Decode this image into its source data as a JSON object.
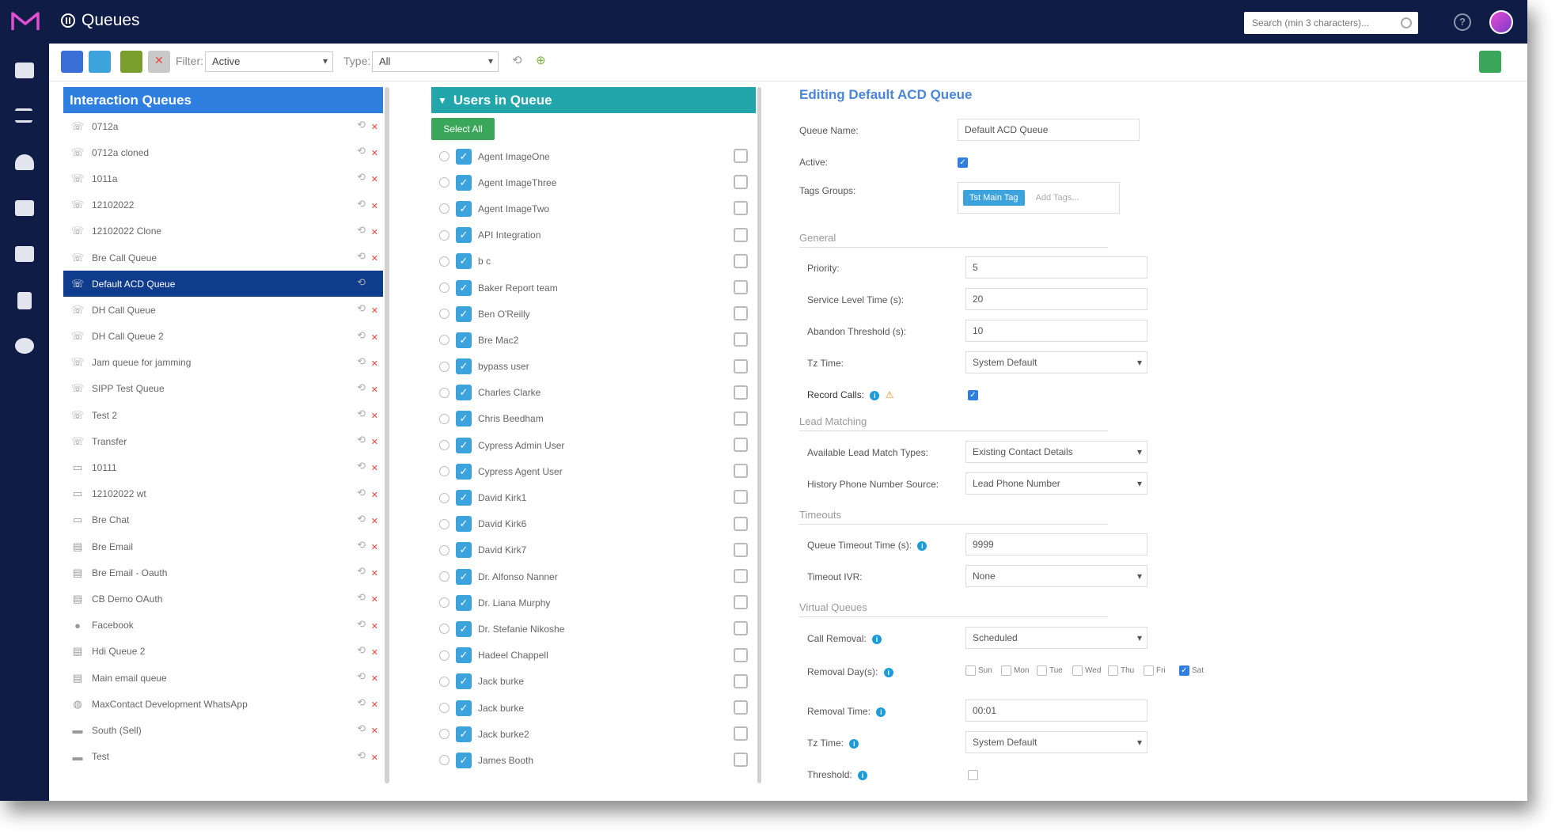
{
  "app": {
    "title": "Queues"
  },
  "header": {
    "search_placeholder": "Search (min 3 characters)..."
  },
  "toolbar": {
    "filter_label": "Filter:",
    "filter_value": "Active",
    "type_label": "Type:",
    "type_value": "All"
  },
  "queues": {
    "header": "Interaction Queues",
    "items": [
      {
        "icon": "phone-icon",
        "name": "0712a",
        "selected": false
      },
      {
        "icon": "phone-icon",
        "name": "0712a cloned",
        "selected": false
      },
      {
        "icon": "phone-icon",
        "name": "1011a",
        "selected": false
      },
      {
        "icon": "phone-icon",
        "name": "12102022",
        "selected": false
      },
      {
        "icon": "phone-icon",
        "name": "12102022 Clone",
        "selected": false
      },
      {
        "icon": "phone-icon",
        "name": "Bre Call Queue",
        "selected": false
      },
      {
        "icon": "phone-icon",
        "name": "Default ACD Queue",
        "selected": true
      },
      {
        "icon": "phone-icon",
        "name": "DH Call Queue",
        "selected": false
      },
      {
        "icon": "phone-icon",
        "name": "DH Call Queue 2",
        "selected": false
      },
      {
        "icon": "phone-icon",
        "name": "Jam queue for jamming",
        "selected": false
      },
      {
        "icon": "phone-icon",
        "name": "SIPP Test Queue",
        "selected": false
      },
      {
        "icon": "phone-icon",
        "name": "Test 2",
        "selected": false
      },
      {
        "icon": "phone-icon",
        "name": "Transfer",
        "selected": false
      },
      {
        "icon": "chat-icon",
        "name": "10111",
        "selected": false
      },
      {
        "icon": "chat-icon",
        "name": "12102022 wt",
        "selected": false
      },
      {
        "icon": "chat-icon",
        "name": "Bre Chat",
        "selected": false
      },
      {
        "icon": "email-icon",
        "name": "Bre Email",
        "selected": false
      },
      {
        "icon": "email-icon",
        "name": "Bre Email - Oauth",
        "selected": false
      },
      {
        "icon": "email-icon",
        "name": "CB Demo OAuth",
        "selected": false
      },
      {
        "icon": "facebook-icon",
        "name": "Facebook",
        "selected": false
      },
      {
        "icon": "email-icon",
        "name": "Hdi Queue 2",
        "selected": false
      },
      {
        "icon": "email-icon",
        "name": "Main email queue",
        "selected": false
      },
      {
        "icon": "whatsapp-icon",
        "name": "MaxContact Development WhatsApp",
        "selected": false
      },
      {
        "icon": "sms-icon",
        "name": "South (Sell)",
        "selected": false
      },
      {
        "icon": "sms-icon",
        "name": "Test",
        "selected": false
      }
    ]
  },
  "users": {
    "header": "Users in Queue",
    "select_all_label": "Select All",
    "items": [
      "Agent ImageOne",
      "Agent ImageThree",
      "Agent ImageTwo",
      "API Integration",
      "b c",
      "Baker Report team",
      "Ben O'Reilly",
      "Bre Mac2",
      "bypass user",
      "Charles Clarke",
      "Chris Beedham",
      "Cypress Admin User",
      "Cypress Agent User",
      "David Kirk1",
      "David Kirk6",
      "David Kirk7",
      "Dr. Alfonso Nanner",
      "Dr. Liana Murphy",
      "Dr. Stefanie Nikoshe",
      "Hadeel Chappell",
      "Jack burke",
      "Jack burke",
      "Jack burke2",
      "James Booth"
    ]
  },
  "editor": {
    "title": "Editing Default ACD Queue",
    "queue_name_label": "Queue Name:",
    "queue_name_value": "Default ACD Queue",
    "active_label": "Active:",
    "tag_groups_label": "Tags Groups:",
    "tag_chip": "Tst Main Tag",
    "add_tags": "Add Tags...",
    "general_section": "General",
    "priority_label": "Priority:",
    "priority_value": "5",
    "service_level_label": "Service Level Time (s):",
    "service_level_value": "20",
    "abandon_label": "Abandon Threshold (s):",
    "abandon_value": "10",
    "tz_label": "Tz Time:",
    "tz_value": "System Default",
    "record_calls_label": "Record Calls:",
    "lead_section": "Lead Matching",
    "lead_types_label": "Available Lead Match Types:",
    "lead_types_value": "Existing Contact Details",
    "history_label": "History Phone Number Source:",
    "history_value": "Lead Phone Number",
    "timeouts_section": "Timeouts",
    "queue_timeout_label": "Queue Timeout Time (s):",
    "queue_timeout_value": "9999",
    "timeout_ivr_label": "Timeout IVR:",
    "timeout_ivr_value": "None",
    "virtual_section": "Virtual Queues",
    "call_removal_label": "Call Removal:",
    "call_removal_value": "Scheduled",
    "removal_days_label": "Removal Day(s):",
    "days": [
      "Sun",
      "Mon",
      "Tue",
      "Wed",
      "Thu",
      "Fri",
      "Sat"
    ],
    "removal_time_label": "Removal Time:",
    "removal_time_value": "00:01",
    "tz2_label": "Tz Time:",
    "tz2_value": "System Default",
    "threshold_label": "Threshold:"
  },
  "colors": {
    "navy": "#0f1c45",
    "queue_header": "#2f7fe0",
    "users_header": "#22a6ab",
    "selected_row": "#0f3c8c",
    "select_all": "#3aa65a"
  }
}
